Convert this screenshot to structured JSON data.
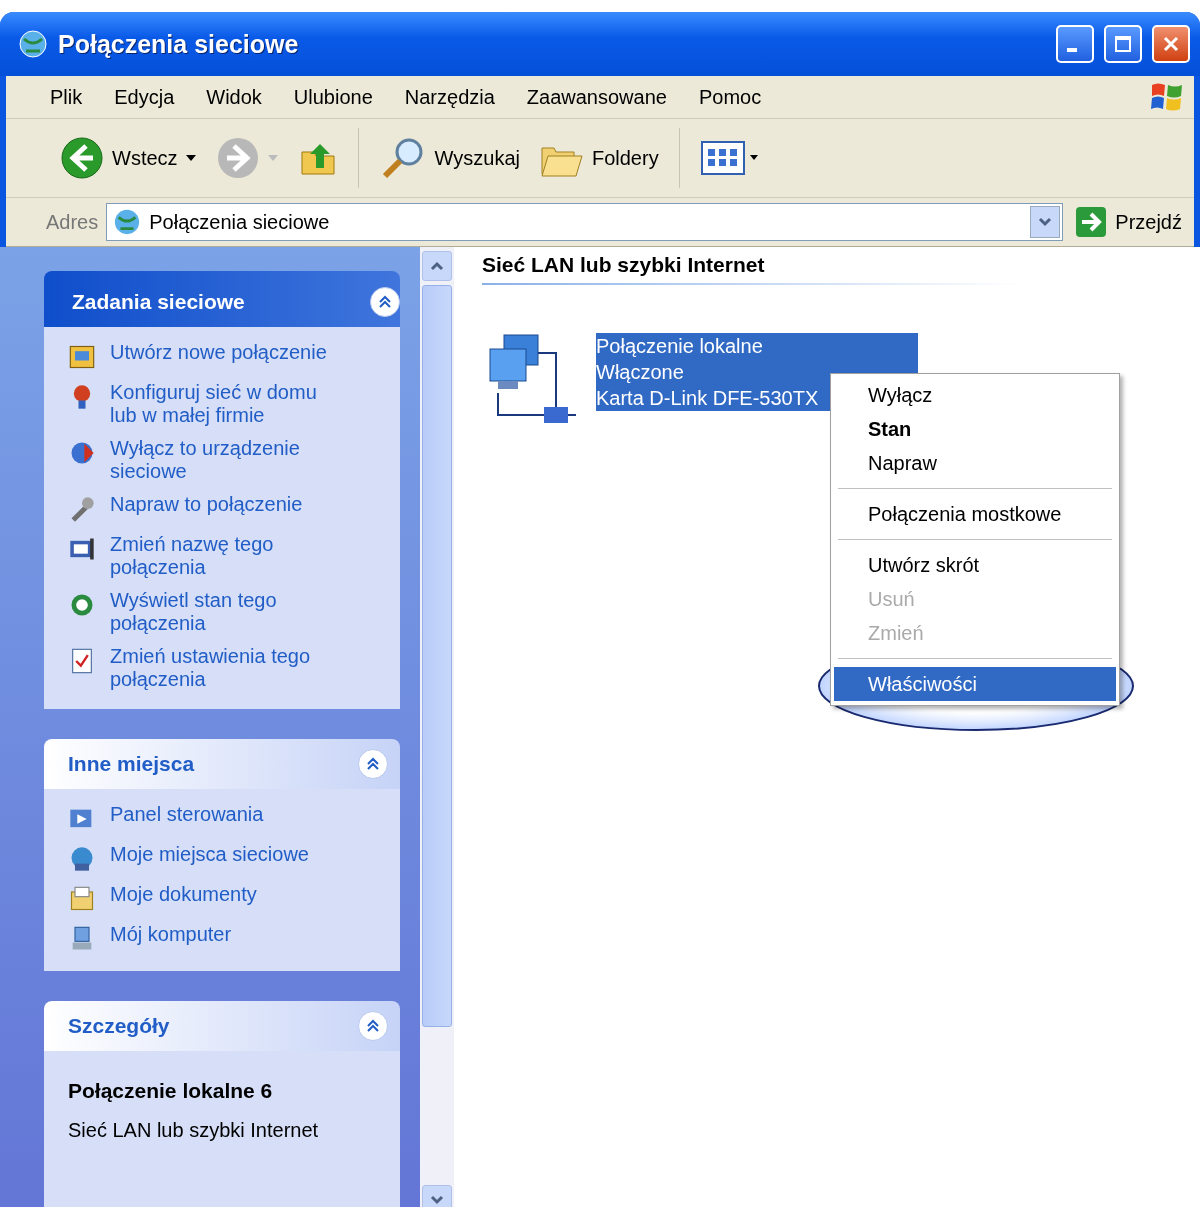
{
  "window": {
    "title": "Połączenia sieciowe"
  },
  "menu_bar": [
    "Plik",
    "Edycja",
    "Widok",
    "Ulubione",
    "Narzędzia",
    "Zaawansowane",
    "Pomoc"
  ],
  "toolbar": [
    {
      "kind": "back",
      "label": "Wstecz",
      "disabled": false
    },
    {
      "kind": "forward",
      "disabled": true
    },
    {
      "kind": "up"
    },
    {
      "kind": "search",
      "label": "Wyszukaj"
    },
    {
      "kind": "folders",
      "label": "Foldery"
    },
    {
      "kind": "views"
    }
  ],
  "address_bar": {
    "label": "Adres",
    "value": "Połączenia sieciowe",
    "go": "Przejdź"
  },
  "task_panels": [
    {
      "title": "Zadania sieciowe",
      "items": [
        "Utwórz nowe połączenie",
        "Konfiguruj sieć w domu lub w małej firmie",
        "Wyłącz to urządzenie sieciowe",
        "Napraw to połączenie",
        "Zmień nazwę tego połączenia",
        "Wyświetl stan tego połączenia",
        "Zmień ustawienia tego połączenia"
      ]
    },
    {
      "title": "Inne miejsca",
      "items": [
        "Panel sterowania",
        "Moje miejsca sieciowe",
        "Moje dokumenty",
        "Mój komputer"
      ]
    }
  ],
  "details_panel": {
    "title": "Szczegóły",
    "name": "Połączenie lokalne 6",
    "type": "Sieć LAN lub szybki Internet"
  },
  "content": {
    "group_header": "Sieć LAN lub szybki Internet",
    "connection": {
      "name": "Połączenie lokalne",
      "status": "Włączone",
      "adapter": "Karta D-Link DFE-530TX",
      "selected": true
    }
  },
  "context_menu": [
    {
      "kind": "item",
      "label": "Wyłącz",
      "bold": false,
      "disabled": false,
      "selected": false
    },
    {
      "kind": "item",
      "label": "Stan",
      "bold": true,
      "disabled": false,
      "selected": false
    },
    {
      "kind": "item",
      "label": "Napraw",
      "bold": false,
      "disabled": false,
      "selected": false
    },
    {
      "kind": "separator"
    },
    {
      "kind": "item",
      "label": "Połączenia mostkowe",
      "bold": false,
      "disabled": false,
      "selected": false
    },
    {
      "kind": "separator"
    },
    {
      "kind": "item",
      "label": "Utwórz skrót",
      "bold": false,
      "disabled": false,
      "selected": false
    },
    {
      "kind": "item",
      "label": "Usuń",
      "bold": false,
      "disabled": true,
      "selected": false
    },
    {
      "kind": "item",
      "label": "Zmień",
      "bold": false,
      "disabled": true,
      "selected": false
    },
    {
      "kind": "separator"
    },
    {
      "kind": "item",
      "label": "Właściwości",
      "bold": false,
      "disabled": false,
      "selected": true
    }
  ]
}
